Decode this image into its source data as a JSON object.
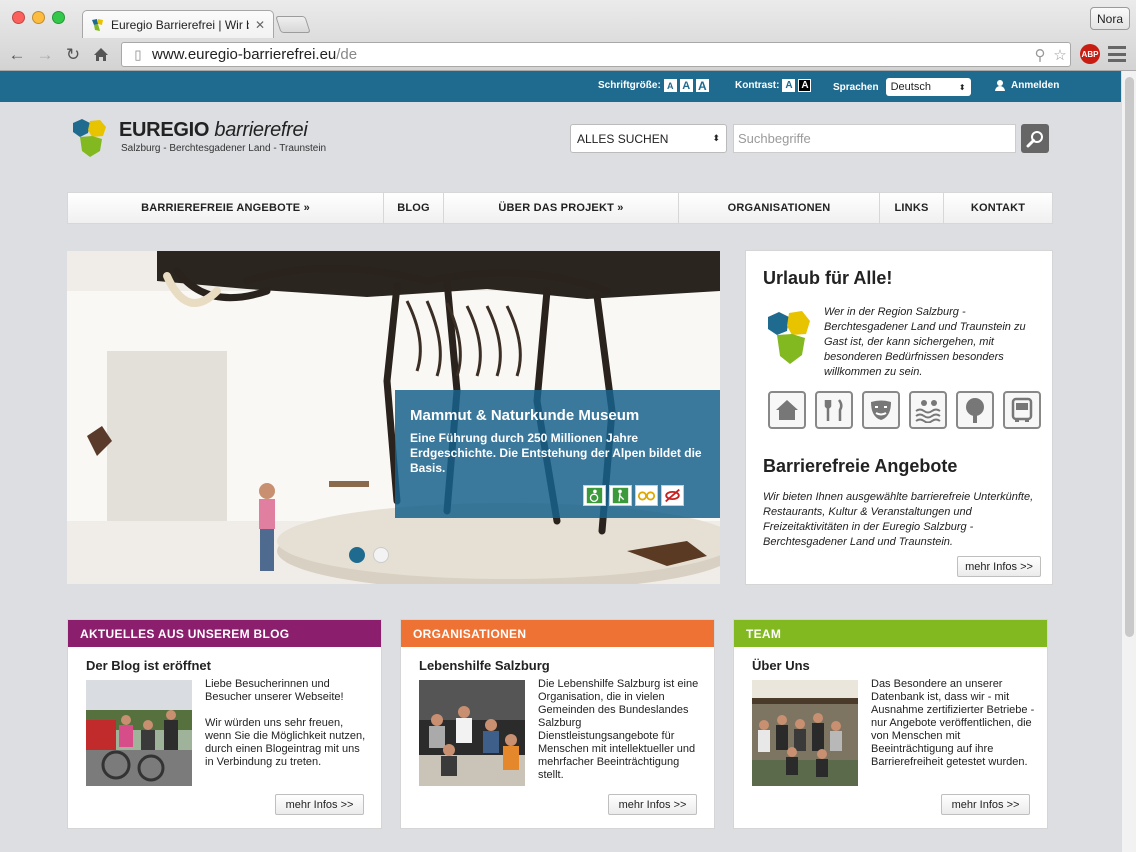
{
  "browser": {
    "tab_title": "Euregio Barrierefrei | Wir b",
    "tab_close": "✕",
    "profile_name": "Nora",
    "url_main": "www.euregio-barrierefrei.eu",
    "url_path": "/de",
    "abp_label": "ABP"
  },
  "topbar": {
    "font_label": "Schriftgröße:",
    "font_sizes": [
      "A",
      "A",
      "A"
    ],
    "contrast_label": "Kontrast:",
    "contrast_options": [
      "A",
      "A"
    ],
    "language_label": "Sprachen",
    "language_value": "Deutsch",
    "login_label": "Anmelden"
  },
  "logo": {
    "title_bold": "EUREGIO",
    "title_italic": "barrierefrei",
    "subtitle": "Salzburg - Berchtesgadener Land - Traunstein"
  },
  "search": {
    "scope": "ALLES SUCHEN",
    "placeholder": "Suchbegriffe"
  },
  "nav": [
    {
      "label": "BARRIEREFREIE ANGEBOTE  »"
    },
    {
      "label": "BLOG"
    },
    {
      "label": "ÜBER DAS PROJEKT  »"
    },
    {
      "label": "ORGANISATIONEN"
    },
    {
      "label": "LINKS"
    },
    {
      "label": "KONTAKT"
    }
  ],
  "slider": {
    "title": "Mammut & Naturkunde Museum",
    "text": "Eine Führung durch 250 Millionen Jahre Erdgeschichte. Die Entstehung der Alpen bildet die Basis.",
    "slide_count": 2,
    "active_slide": 1
  },
  "sidebox": {
    "heading1": "Urlaub für Alle!",
    "intro": "Wer in der Region Salzburg - Berchtesgadener Land und Traunstein zu Gast ist, der kann sichergehen, mit besonderen Bedürfnissen besonders willkommen zu sein.",
    "icons": [
      "house-icon",
      "cutlery-icon",
      "theater-mask-icon",
      "swimming-icon",
      "tree-icon",
      "bus-icon"
    ],
    "heading2": "Barrierefreie Angebote",
    "text": "Wir bieten Ihnen ausgewählte barrierefreie Unterkünfte, Restaurants, Kultur & Veranstaltungen und Freizeitaktivitäten in der Euregio Salzburg - Berchtesgadener Land und Traunstein.",
    "more": "mehr Infos >>"
  },
  "cards": [
    {
      "header": "AKTUELLES AUS UNSEREM BLOG",
      "color": "#8b1f6e",
      "title": "Der Blog ist eröffnet",
      "text": "Liebe Besucherinnen und Besucher unserer Webseite!\n\nWir würden uns sehr freuen, wenn Sie die Möglichkeit nutzen, durch einen Blogeintrag mit uns in Verbindung zu treten.",
      "more": "mehr Infos >>"
    },
    {
      "header": "ORGANISATIONEN",
      "color": "#ee7234",
      "title": "Lebenshilfe Salzburg",
      "text": "Die Lebenshilfe Salzburg ist eine Organisation, die in vielen Gemeinden des Bundeslandes Salzburg Dienstleistungsangebote für Menschen mit intellektueller und mehrfacher Beeinträchtigung stellt.",
      "more": "mehr Infos >>"
    },
    {
      "header": "TEAM",
      "color": "#82b921",
      "title": "Über Uns",
      "text": "Das Besondere an unserer Datenbank ist, dass wir - mit Ausnahme zertifizierter Betriebe  - nur Angebote veröffentlichen, die von Menschen mit Beeinträchtigung auf ihre Barrierefreiheit getestet wurden.",
      "more": "mehr Infos >>"
    }
  ]
}
